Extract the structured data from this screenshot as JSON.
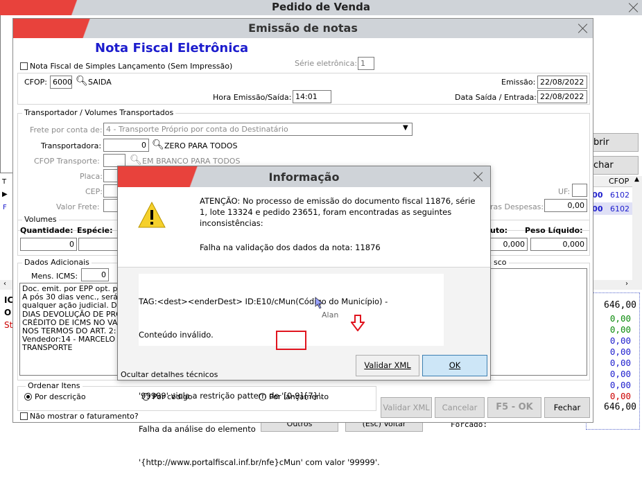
{
  "background_window": {
    "title": "Pedido de Venda",
    "buttons": {
      "abrir": "brir",
      "fechar": "char"
    },
    "grid": {
      "header_cfop": "CFOP",
      "header_t": "T",
      "row1_value": ",00",
      "row1_cfop": "6102",
      "row2_value": ",00",
      "row2_cfop": "6102",
      "row_marker_f": "F",
      "row_marker_s": "S"
    },
    "bottom_left": {
      "c1": "IC",
      "c2": "O",
      "c3": "St"
    },
    "totals": [
      "646,00",
      "0,00",
      "0,00",
      "0,00",
      "0,00",
      "0,00",
      "0,00",
      "0,00",
      "0,00",
      "646,00"
    ],
    "forcado_label": "Forcado:",
    "bottom_buttons": {
      "outros": "Outros",
      "voltar": "(Esc) Voltar"
    }
  },
  "emissao_window": {
    "title": "Emissão de notas",
    "heading": "Nota Fiscal Eletrônica",
    "simples_checkbox_label": "Nota Fiscal de Simples Lançamento (Sem Impressão)",
    "serie_label": "Série eletrônica:",
    "serie_value": "1",
    "cfop_label": "CFOP:",
    "cfop_value": "6000",
    "cfop_desc": "SAIDA",
    "emissao_label": "Emissão:",
    "emissao_value": "22/08/2022",
    "hora_label": "Hora Emissão/Saída:",
    "hora_value": "14:01",
    "data_saida_label": "Data Saída / Entrada:",
    "data_saida_value": "22/08/2022",
    "transport_group": "Transportador /  Volumes Transportados",
    "frete_label": "Frete por conta de:",
    "frete_value": "4 - Transporte Próprio por conta do Destinatário",
    "transportadora_label": "Transportadora:",
    "transportadora_value": "0",
    "transportadora_desc": "ZERO PARA TODOS",
    "cfop_transporte_label": "CFOP Transporte:",
    "cfop_transporte_desc": "EM BRANCO PARA TODOS",
    "placa_label": "Placa:",
    "cep_label": "CEP:",
    "uf_label": "UF:",
    "valor_frete_label": "Valor Frete:",
    "outras_despesas_label": "ras Despesas:",
    "outras_despesas_value": "0,00",
    "volumes_group": "Volumes",
    "quantidade_label": "Quantidade:",
    "quantidade_value": "0",
    "especie_label": "Espécie:",
    "peso_bruto_label": "uto:",
    "peso_bruto_value": "0,000",
    "peso_liquido_label": "Peso Líquido:",
    "peso_liquido_value": "0,000",
    "dados_group": "Dados Adicionais",
    "mens_icms_label": "Mens. ICMS:",
    "mens_icms_value": "0",
    "right_group_title": "sco",
    "dados_text": [
      "Doc. emit. por EPP opt. pe",
      "A pós 30 dias venc., será",
      "qualquer ação judicial. De",
      "DIAS DEVOLUÇÃO DE PRO",
      "CRÉDITO DE ICMS NO VA",
      "NOS TERMOS DO ART. 2:",
      "Vendedor:14 - MARCELO",
      "TRANSPORTE"
    ],
    "ordenar_group": "Ordenar Itens",
    "ord_descricao": "Por descrição",
    "ord_codigo": "Por código",
    "ord_lancamento": "Por lançamento",
    "nao_mostrar_label": "Não mostrar o faturamento?",
    "btn_validar": "Validar XML",
    "btn_cancelar": "Cancelar",
    "btn_f5": "F5 - OK",
    "btn_fechar": "Fechar"
  },
  "info_dialog": {
    "title": "Informação",
    "message_1": "ATENÇÃO: No processo de emissão do documento fiscal 11876, série 1, lote 13324 e pedido 23651, foram encontradas as seguintes inconsistências:",
    "message_2": "Falha na validação dos dados da nota: 11876",
    "details": [
      "TAG:<dest><enderDest> ID:E10/cMun(Código do Município) -",
      "Conteúdo inválido.",
      "",
      "'99999' viola a restrição pattern de '[0-9]{7}'.",
      "Falha da análise do elemento",
      "'{http://www.portalfiscal.inf.br/nfe}cMun' com valor '99999'."
    ],
    "cursor_tooltip": "Alan",
    "hide_details": "Ocultar detalhes técnicos",
    "btn_validar": "Validar XML",
    "btn_ok": "OK"
  },
  "colors": {
    "accent_red": "#e8423c",
    "blue_heading": "#1c1ccd",
    "annotation_red": "#e0141e"
  }
}
